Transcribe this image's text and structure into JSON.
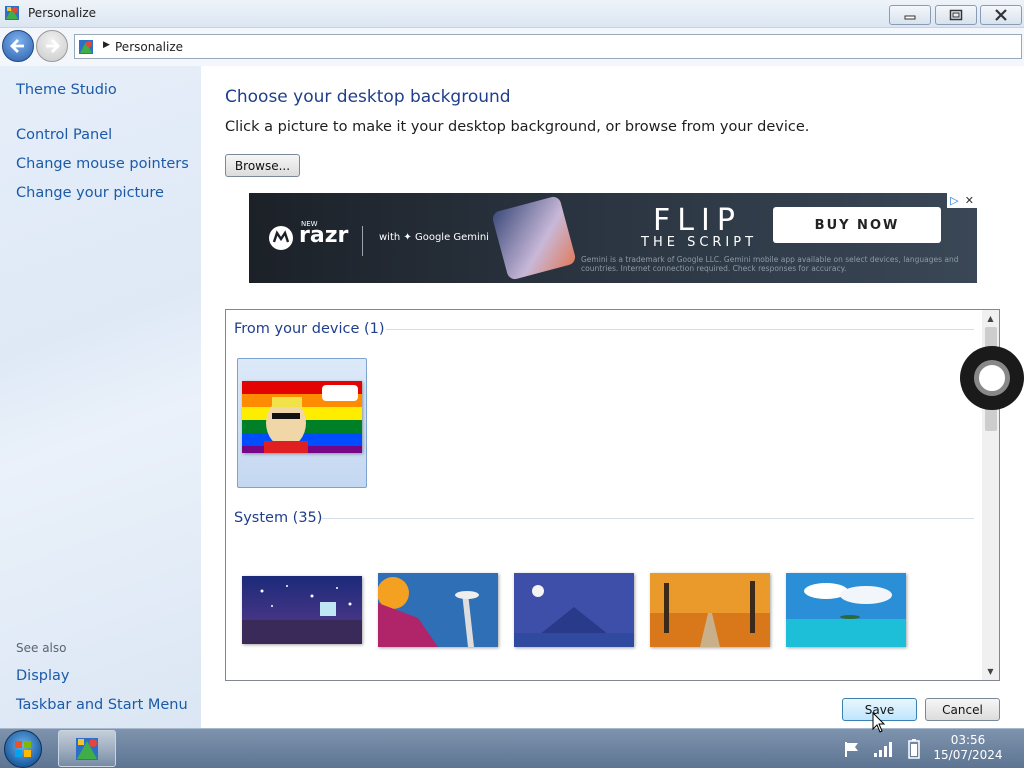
{
  "window": {
    "title": "Personalize"
  },
  "addressbar": {
    "path": "Personalize"
  },
  "sidebar": {
    "links": [
      {
        "label": "Theme Studio"
      },
      {
        "label": "Control Panel"
      },
      {
        "label": "Change mouse pointers"
      },
      {
        "label": "Change your picture"
      }
    ],
    "see_also_label": "See also",
    "see_also_links": [
      {
        "label": "Display"
      },
      {
        "label": "Taskbar and Start Menu"
      }
    ]
  },
  "main": {
    "heading": "Choose your desktop background",
    "subtext": "Click a picture to make it your desktop background, or browse from your device.",
    "browse_label": "Browse..."
  },
  "ad": {
    "brand_new": "NEW",
    "brand": "razr",
    "with_text": "with ✦ Google Gemini",
    "headline": "FLIP",
    "subheadline": "THE SCRIPT",
    "cta": "BUY NOW",
    "fine_print": "Gemini is a trademark of Google LLC. Gemini mobile app available on select devices, languages and countries. Internet connection required. Check responses for accuracy."
  },
  "gallery": {
    "groups": [
      {
        "title": "From your device (1)"
      },
      {
        "title": "System (35)"
      }
    ],
    "selected_index": 0
  },
  "actions": {
    "save_label": "Save",
    "cancel_label": "Cancel"
  },
  "taskbar": {
    "time": "03:56",
    "date": "15/07/2024"
  },
  "colors": {
    "link": "#1c5aa8",
    "heading": "#1f3e8c",
    "taskbar": "#6a819e"
  }
}
